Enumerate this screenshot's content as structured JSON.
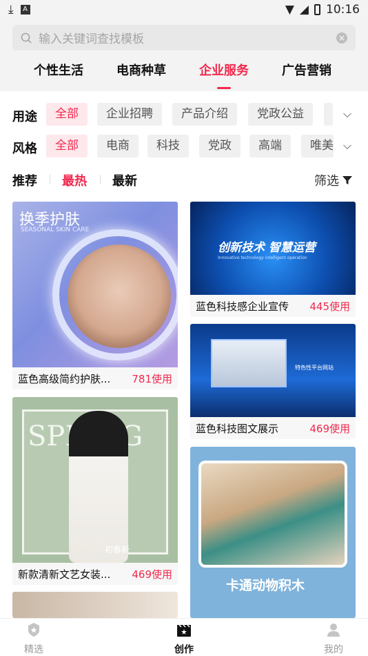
{
  "status": {
    "time": "10:16"
  },
  "search": {
    "placeholder": "输入关键词查找模板"
  },
  "tabs": [
    {
      "label": "个性生活",
      "active": false
    },
    {
      "label": "电商种草",
      "active": false
    },
    {
      "label": "企业服务",
      "active": true
    },
    {
      "label": "广告营销",
      "active": false
    }
  ],
  "filters": {
    "use": {
      "label": "用途",
      "chips": [
        "全部",
        "企业招聘",
        "产品介绍",
        "党政公益"
      ]
    },
    "style": {
      "label": "风格",
      "chips": [
        "全部",
        "电商",
        "科技",
        "党政",
        "高端",
        "唯美"
      ]
    }
  },
  "sort": {
    "recommend": "推荐",
    "hot": "最热",
    "newest": "最新",
    "filter": "筛选"
  },
  "cards": [
    {
      "title": "蓝色高级简约护肤...",
      "uses": "781使用",
      "overlay": "换季护肤",
      "overlay_sub": "SEASONAL SKIN CARE"
    },
    {
      "title": "蓝色科技感企业宣传",
      "uses": "445使用",
      "overlay": "创新技术 智慧运营",
      "overlay_sub": "Innovative technology intelligent operation"
    },
    {
      "title": "蓝色科技图文展示",
      "uses": "469使用",
      "overlay": "特色性平台网站"
    },
    {
      "title": "新款清新文艺女装...",
      "uses": "469使用",
      "overlay": "SPRING",
      "overlay_sub": "初春新"
    },
    {
      "title": "",
      "uses": "",
      "overlay": "卡通动物积木"
    }
  ],
  "nav": {
    "featured": "精选",
    "create": "创作",
    "mine": "我的"
  },
  "colors": {
    "accent": "#f2284d"
  }
}
